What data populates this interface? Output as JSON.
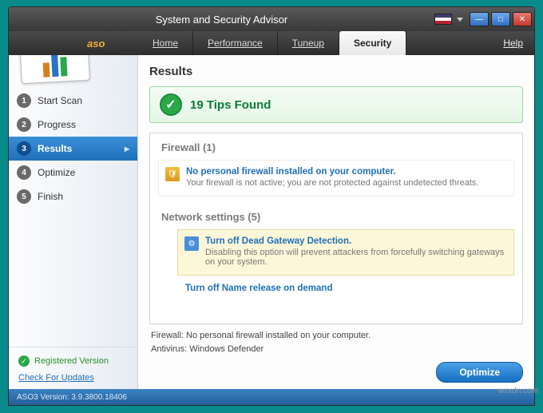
{
  "window": {
    "title": "System and Security Advisor"
  },
  "brand": "aso",
  "menu": {
    "items": [
      "Home",
      "Performance",
      "Tuneup",
      "Security"
    ],
    "active_index": 3,
    "help": "Help"
  },
  "sidebar": {
    "steps": [
      {
        "num": "1",
        "label": "Start Scan"
      },
      {
        "num": "2",
        "label": "Progress"
      },
      {
        "num": "3",
        "label": "Results"
      },
      {
        "num": "4",
        "label": "Optimize"
      },
      {
        "num": "5",
        "label": "Finish"
      }
    ],
    "active_index": 2,
    "registered": "Registered Version",
    "updates": "Check For Updates"
  },
  "main": {
    "heading": "Results",
    "tips_found": "19 Tips Found",
    "sections": {
      "firewall": {
        "title": "Firewall   (1)",
        "item": {
          "title": "No personal firewall installed on your computer.",
          "desc": "Your firewall is not active; you are not protected against undetected threats."
        }
      },
      "network": {
        "title": "Network settings   (5)",
        "item": {
          "title": "Turn off Dead Gateway Detection.",
          "desc": "Disabling this option will prevent attackers from forcefully switching gateways on your system."
        },
        "truncated": "Turn off Name release on demand"
      }
    },
    "status": {
      "line1": "Firewall: No personal firewall installed on your computer.",
      "line2": "Antivirus: Windows Defender"
    },
    "optimize_btn": "Optimize"
  },
  "footer": {
    "version": "ASO3 Version: 3.9.3800.18406"
  },
  "watermark": "wsxdn.com"
}
